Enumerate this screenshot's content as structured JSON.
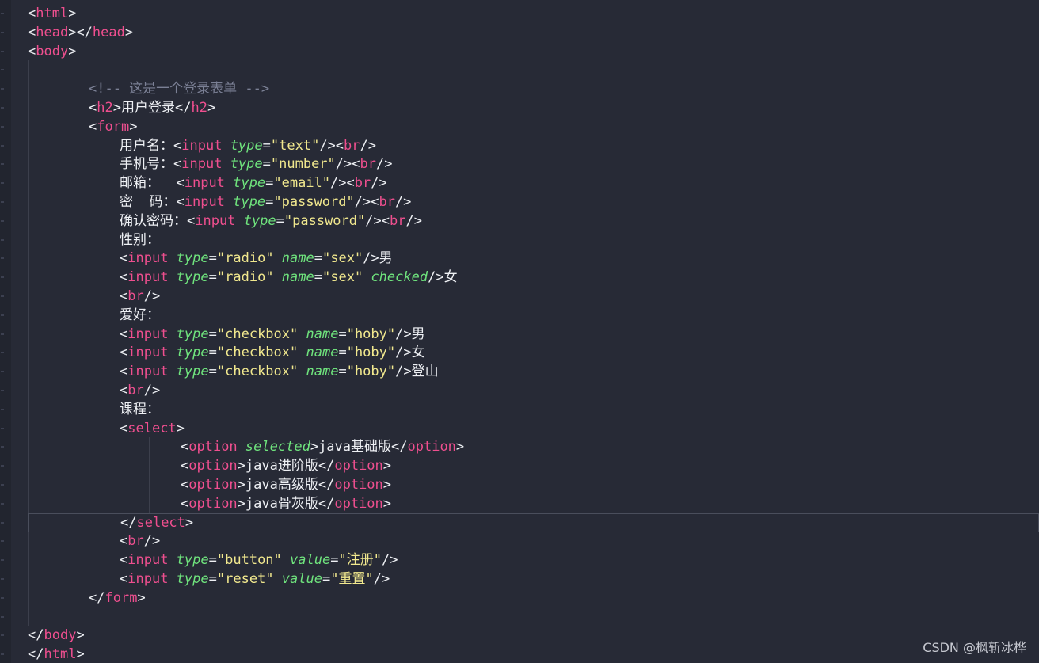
{
  "editor": {
    "lines": [
      {
        "indent": 0,
        "tokens": [
          [
            "punct",
            "<"
          ],
          [
            "tag",
            "html"
          ],
          [
            "punct",
            ">"
          ]
        ]
      },
      {
        "indent": 0,
        "tokens": [
          [
            "punct",
            "<"
          ],
          [
            "tag",
            "head"
          ],
          [
            "punct",
            "></"
          ],
          [
            "tag",
            "head"
          ],
          [
            "punct",
            ">"
          ]
        ]
      },
      {
        "indent": 0,
        "tokens": [
          [
            "punct",
            "<"
          ],
          [
            "tag",
            "body"
          ],
          [
            "punct",
            ">"
          ]
        ]
      },
      {
        "indent": 0,
        "tokens": []
      },
      {
        "indent": 2,
        "tokens": [
          [
            "comment",
            "<!-- 这是一个登录表单 -->"
          ]
        ]
      },
      {
        "indent": 2,
        "tokens": [
          [
            "punct",
            "<"
          ],
          [
            "tag",
            "h2"
          ],
          [
            "punct",
            ">"
          ],
          [
            "text",
            "用户登录"
          ],
          [
            "punct",
            "</"
          ],
          [
            "tag",
            "h2"
          ],
          [
            "punct",
            ">"
          ]
        ]
      },
      {
        "indent": 2,
        "tokens": [
          [
            "punct",
            "<"
          ],
          [
            "tag",
            "form"
          ],
          [
            "punct",
            ">"
          ]
        ]
      },
      {
        "indent": 3,
        "tokens": [
          [
            "text",
            "用户名："
          ],
          [
            "punct",
            "<"
          ],
          [
            "tag",
            "input"
          ],
          [
            "text",
            " "
          ],
          [
            "attr",
            "type"
          ],
          [
            "punct",
            "="
          ],
          [
            "str",
            "\"text\""
          ],
          [
            "punct",
            "/><"
          ],
          [
            "tag",
            "br"
          ],
          [
            "punct",
            "/>"
          ]
        ]
      },
      {
        "indent": 3,
        "tokens": [
          [
            "text",
            "手机号："
          ],
          [
            "punct",
            "<"
          ],
          [
            "tag",
            "input"
          ],
          [
            "text",
            " "
          ],
          [
            "attr",
            "type"
          ],
          [
            "punct",
            "="
          ],
          [
            "str",
            "\"number\""
          ],
          [
            "punct",
            "/><"
          ],
          [
            "tag",
            "br"
          ],
          [
            "punct",
            "/>"
          ]
        ]
      },
      {
        "indent": 3,
        "tokens": [
          [
            "text",
            "邮箱：  "
          ],
          [
            "punct",
            "<"
          ],
          [
            "tag",
            "input"
          ],
          [
            "text",
            " "
          ],
          [
            "attr",
            "type"
          ],
          [
            "punct",
            "="
          ],
          [
            "str",
            "\"email\""
          ],
          [
            "punct",
            "/><"
          ],
          [
            "tag",
            "br"
          ],
          [
            "punct",
            "/>"
          ]
        ]
      },
      {
        "indent": 3,
        "tokens": [
          [
            "text",
            "密  码："
          ],
          [
            "punct",
            "<"
          ],
          [
            "tag",
            "input"
          ],
          [
            "text",
            " "
          ],
          [
            "attr",
            "type"
          ],
          [
            "punct",
            "="
          ],
          [
            "str",
            "\"password\""
          ],
          [
            "punct",
            "/><"
          ],
          [
            "tag",
            "br"
          ],
          [
            "punct",
            "/>"
          ]
        ]
      },
      {
        "indent": 3,
        "tokens": [
          [
            "text",
            "确认密码："
          ],
          [
            "punct",
            "<"
          ],
          [
            "tag",
            "input"
          ],
          [
            "text",
            " "
          ],
          [
            "attr",
            "type"
          ],
          [
            "punct",
            "="
          ],
          [
            "str",
            "\"password\""
          ],
          [
            "punct",
            "/><"
          ],
          [
            "tag",
            "br"
          ],
          [
            "punct",
            "/>"
          ]
        ]
      },
      {
        "indent": 3,
        "tokens": [
          [
            "text",
            "性别："
          ]
        ]
      },
      {
        "indent": 3,
        "tokens": [
          [
            "punct",
            "<"
          ],
          [
            "tag",
            "input"
          ],
          [
            "text",
            " "
          ],
          [
            "attr",
            "type"
          ],
          [
            "punct",
            "="
          ],
          [
            "str",
            "\"radio\""
          ],
          [
            "text",
            " "
          ],
          [
            "attr",
            "name"
          ],
          [
            "punct",
            "="
          ],
          [
            "str",
            "\"sex\""
          ],
          [
            "punct",
            "/>"
          ],
          [
            "text",
            "男"
          ]
        ]
      },
      {
        "indent": 3,
        "tokens": [
          [
            "punct",
            "<"
          ],
          [
            "tag",
            "input"
          ],
          [
            "text",
            " "
          ],
          [
            "attr",
            "type"
          ],
          [
            "punct",
            "="
          ],
          [
            "str",
            "\"radio\""
          ],
          [
            "text",
            " "
          ],
          [
            "attr",
            "name"
          ],
          [
            "punct",
            "="
          ],
          [
            "str",
            "\"sex\""
          ],
          [
            "text",
            " "
          ],
          [
            "attr",
            "checked"
          ],
          [
            "punct",
            "/>"
          ],
          [
            "text",
            "女"
          ]
        ]
      },
      {
        "indent": 3,
        "tokens": [
          [
            "punct",
            "<"
          ],
          [
            "tag",
            "br"
          ],
          [
            "punct",
            "/>"
          ]
        ]
      },
      {
        "indent": 3,
        "tokens": [
          [
            "text",
            "爱好："
          ]
        ]
      },
      {
        "indent": 3,
        "tokens": [
          [
            "punct",
            "<"
          ],
          [
            "tag",
            "input"
          ],
          [
            "text",
            " "
          ],
          [
            "attr",
            "type"
          ],
          [
            "punct",
            "="
          ],
          [
            "str",
            "\"checkbox\""
          ],
          [
            "text",
            " "
          ],
          [
            "attr",
            "name"
          ],
          [
            "punct",
            "="
          ],
          [
            "str",
            "\"hoby\""
          ],
          [
            "punct",
            "/>"
          ],
          [
            "text",
            "男"
          ]
        ]
      },
      {
        "indent": 3,
        "tokens": [
          [
            "punct",
            "<"
          ],
          [
            "tag",
            "input"
          ],
          [
            "text",
            " "
          ],
          [
            "attr",
            "type"
          ],
          [
            "punct",
            "="
          ],
          [
            "str",
            "\"checkbox\""
          ],
          [
            "text",
            " "
          ],
          [
            "attr",
            "name"
          ],
          [
            "punct",
            "="
          ],
          [
            "str",
            "\"hoby\""
          ],
          [
            "punct",
            "/>"
          ],
          [
            "text",
            "女"
          ]
        ]
      },
      {
        "indent": 3,
        "tokens": [
          [
            "punct",
            "<"
          ],
          [
            "tag",
            "input"
          ],
          [
            "text",
            " "
          ],
          [
            "attr",
            "type"
          ],
          [
            "punct",
            "="
          ],
          [
            "str",
            "\"checkbox\""
          ],
          [
            "text",
            " "
          ],
          [
            "attr",
            "name"
          ],
          [
            "punct",
            "="
          ],
          [
            "str",
            "\"hoby\""
          ],
          [
            "punct",
            "/>"
          ],
          [
            "text",
            "登山"
          ]
        ]
      },
      {
        "indent": 3,
        "tokens": [
          [
            "punct",
            "<"
          ],
          [
            "tag",
            "br"
          ],
          [
            "punct",
            "/>"
          ]
        ]
      },
      {
        "indent": 3,
        "tokens": [
          [
            "text",
            "课程："
          ]
        ]
      },
      {
        "indent": 3,
        "tokens": [
          [
            "punct",
            "<"
          ],
          [
            "tag",
            "select"
          ],
          [
            "punct",
            ">"
          ]
        ]
      },
      {
        "indent": 5,
        "tokens": [
          [
            "punct",
            "<"
          ],
          [
            "tag",
            "option"
          ],
          [
            "text",
            " "
          ],
          [
            "attr",
            "selected"
          ],
          [
            "punct",
            ">"
          ],
          [
            "text",
            "java基础版"
          ],
          [
            "punct",
            "</"
          ],
          [
            "tag",
            "option"
          ],
          [
            "punct",
            ">"
          ]
        ]
      },
      {
        "indent": 5,
        "tokens": [
          [
            "punct",
            "<"
          ],
          [
            "tag",
            "option"
          ],
          [
            "punct",
            ">"
          ],
          [
            "text",
            "java进阶版"
          ],
          [
            "punct",
            "</"
          ],
          [
            "tag",
            "option"
          ],
          [
            "punct",
            ">"
          ]
        ]
      },
      {
        "indent": 5,
        "tokens": [
          [
            "punct",
            "<"
          ],
          [
            "tag",
            "option"
          ],
          [
            "punct",
            ">"
          ],
          [
            "text",
            "java高级版"
          ],
          [
            "punct",
            "</"
          ],
          [
            "tag",
            "option"
          ],
          [
            "punct",
            ">"
          ]
        ]
      },
      {
        "indent": 5,
        "tokens": [
          [
            "punct",
            "<"
          ],
          [
            "tag",
            "option"
          ],
          [
            "punct",
            ">"
          ],
          [
            "text",
            "java骨灰版"
          ],
          [
            "punct",
            "</"
          ],
          [
            "tag",
            "option"
          ],
          [
            "punct",
            ">"
          ]
        ]
      },
      {
        "indent": 3,
        "current": true,
        "tokens": [
          [
            "punct",
            "</"
          ],
          [
            "tag",
            "select"
          ],
          [
            "punct",
            ">"
          ]
        ]
      },
      {
        "indent": 3,
        "tokens": [
          [
            "punct",
            "<"
          ],
          [
            "tag",
            "br"
          ],
          [
            "punct",
            "/>"
          ]
        ]
      },
      {
        "indent": 3,
        "tokens": [
          [
            "punct",
            "<"
          ],
          [
            "tag",
            "input"
          ],
          [
            "text",
            " "
          ],
          [
            "attr",
            "type"
          ],
          [
            "punct",
            "="
          ],
          [
            "str",
            "\"button\""
          ],
          [
            "text",
            " "
          ],
          [
            "attr",
            "value"
          ],
          [
            "punct",
            "="
          ],
          [
            "str",
            "\"注册\""
          ],
          [
            "punct",
            "/>"
          ]
        ]
      },
      {
        "indent": 3,
        "tokens": [
          [
            "punct",
            "<"
          ],
          [
            "tag",
            "input"
          ],
          [
            "text",
            " "
          ],
          [
            "attr",
            "type"
          ],
          [
            "punct",
            "="
          ],
          [
            "str",
            "\"reset\""
          ],
          [
            "text",
            " "
          ],
          [
            "attr",
            "value"
          ],
          [
            "punct",
            "="
          ],
          [
            "str",
            "\"重置\""
          ],
          [
            "punct",
            "/>"
          ]
        ]
      },
      {
        "indent": 2,
        "tokens": [
          [
            "punct",
            "</"
          ],
          [
            "tag",
            "form"
          ],
          [
            "punct",
            ">"
          ]
        ]
      },
      {
        "indent": 0,
        "tokens": []
      },
      {
        "indent": 0,
        "tokens": [
          [
            "punct",
            "</"
          ],
          [
            "tag",
            "body"
          ],
          [
            "punct",
            ">"
          ]
        ]
      },
      {
        "indent": 0,
        "tokens": [
          [
            "punct",
            "</"
          ],
          [
            "tag",
            "html"
          ],
          [
            "punct",
            ">"
          ]
        ]
      }
    ]
  },
  "watermark": "CSDN @枫斩冰桦",
  "colors": {
    "background": "#272a36",
    "tag": "#ef4f8f",
    "attribute": "#6fe37d",
    "string": "#f1e88e",
    "text": "#eef0f4",
    "comment": "#7b8095"
  }
}
